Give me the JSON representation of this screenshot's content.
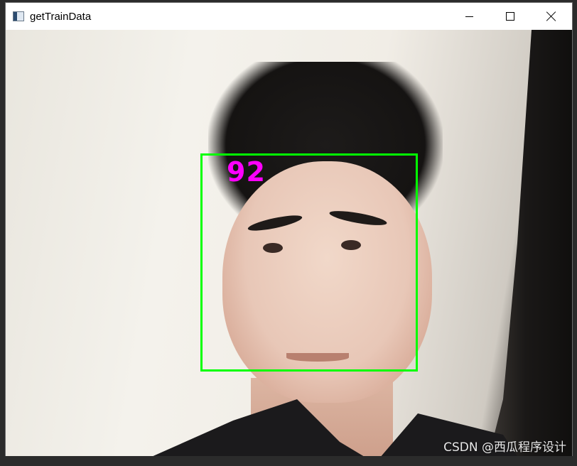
{
  "window": {
    "title": "getTrainData",
    "icon": "app-icon",
    "controls": [
      "minimize-icon",
      "maximize-icon",
      "close-icon"
    ]
  },
  "video": {
    "detection": {
      "label": "92",
      "box_color": "#00ff00",
      "label_color": "#ff00ff"
    }
  },
  "watermark": "CSDN @西瓜程序设计"
}
